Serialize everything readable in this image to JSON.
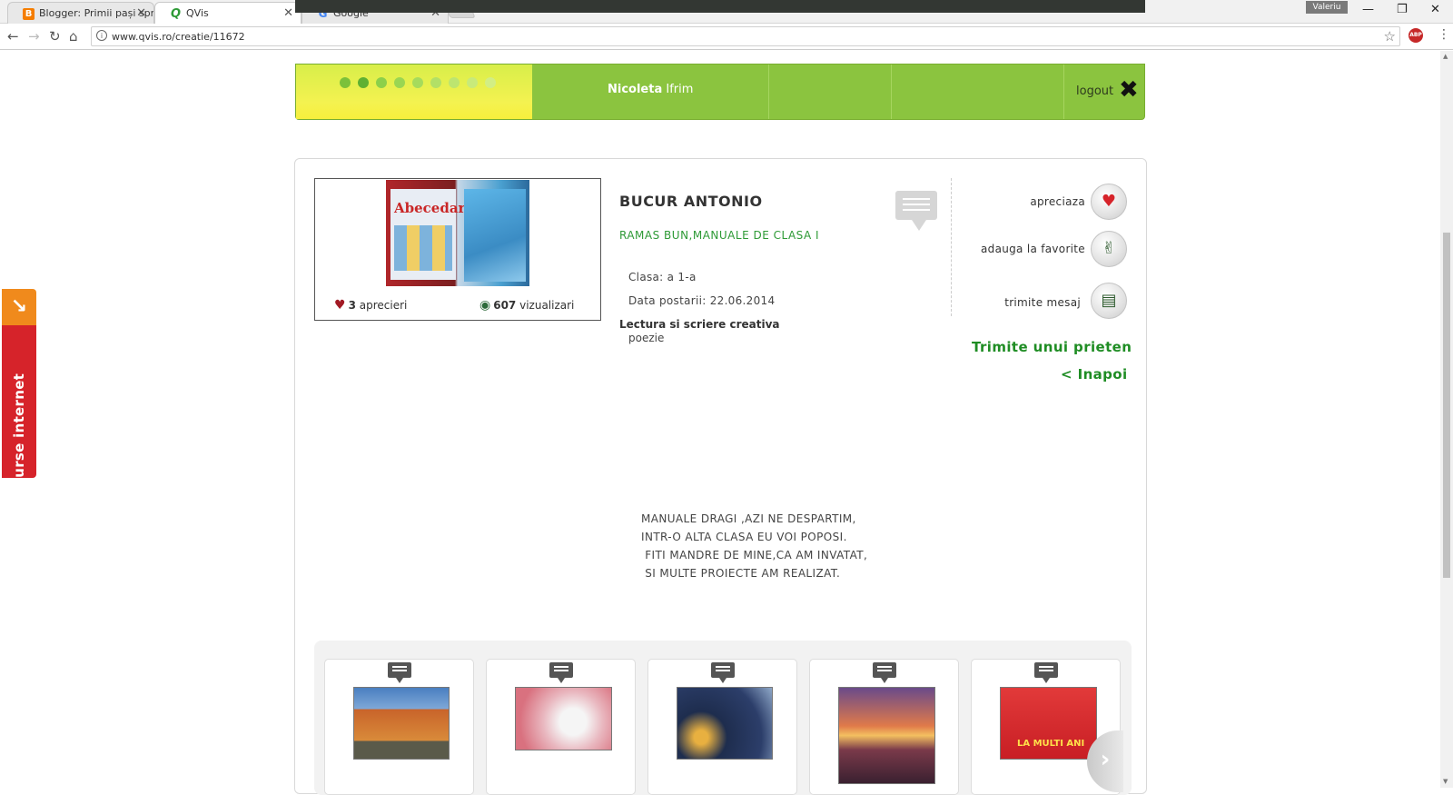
{
  "browser": {
    "tabs": [
      {
        "title": "Blogger: Primii pași spre",
        "favicon": "blogger-icon",
        "color": "#f57d00"
      },
      {
        "title": "QVis",
        "favicon": "qvis-icon",
        "color": "#2e9a36"
      },
      {
        "title": "Google",
        "favicon": "google-icon",
        "color": "#4285f4"
      }
    ],
    "window_user": "Valeriu",
    "url": "www.qvis.ro/creatie/11672"
  },
  "header": {
    "user_first": "Nicoleta",
    "user_last": "Ifrim",
    "logout_label": "logout"
  },
  "sidetab": {
    "label": "resurse internet"
  },
  "creation": {
    "author": "BUCUR ANTONIO",
    "title": "RAMAS BUN,MANUALE DE CLASA I",
    "likes_count": "3",
    "likes_label": "aprecieri",
    "views_count": "607",
    "views_label": "vizualizari",
    "clasa": "Clasa: a 1-a",
    "data_postarii": "Data postarii: 22.06.2014",
    "category": "Lectura si scriere creativa",
    "subcategory": "poezie",
    "image_text": "Abecedar"
  },
  "actions": {
    "like": "apreciaza",
    "favorite": "adauga la favorite",
    "message": "trimite mesaj",
    "send_friend": "Trimite unui prieten",
    "back": "< Inapoi"
  },
  "poem": [
    "MANUALE DRAGI ,AZI NE DESPARTIM,",
    "INTR-O ALTA CLASA EU VOI POPOSI.",
    " FITI MANDRE DE MINE,CA AM INVATAT,",
    " SI MULTE PROIECTE AM REALIZAT."
  ],
  "gallery": {
    "thumb5_text": "LA MULTI ANI"
  }
}
